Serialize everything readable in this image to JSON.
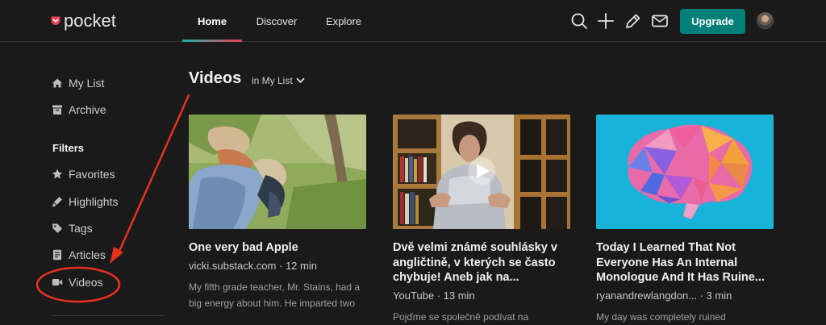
{
  "header": {
    "logo_text": "pocket",
    "nav": [
      {
        "label": "Home",
        "active": true
      },
      {
        "label": "Discover",
        "active": false
      },
      {
        "label": "Explore",
        "active": false
      }
    ],
    "icons": [
      "search-icon",
      "plus-icon",
      "pencil-icon",
      "mail-icon"
    ],
    "upgrade_label": "Upgrade",
    "accent_color": "#008078"
  },
  "sidebar": {
    "items": [
      {
        "label": "My List",
        "icon": "home-icon"
      },
      {
        "label": "Archive",
        "icon": "archive-icon"
      }
    ],
    "filters_heading": "Filters",
    "filters": [
      {
        "label": "Favorites",
        "icon": "star-icon"
      },
      {
        "label": "Highlights",
        "icon": "highlighter-icon"
      },
      {
        "label": "Tags",
        "icon": "tag-icon"
      },
      {
        "label": "Articles",
        "icon": "article-icon"
      },
      {
        "label": "Videos",
        "icon": "video-icon",
        "active": true
      }
    ]
  },
  "main": {
    "title": "Videos",
    "filter_label": "in My List",
    "cards": [
      {
        "title": "One very bad Apple",
        "source": "vicki.substack.com",
        "separator": " · ",
        "duration": "12 min",
        "excerpt": "My fifth grade teacher, Mr. Stains, had a big energy about him. He imparted two"
      },
      {
        "title": "Dvě velmi známé souhlásky v angličtině, v kterých se často chybuje! Aneb jak na...",
        "source": "YouTube",
        "separator": " · ",
        "duration": "13 min",
        "excerpt": "Pojďme se společně podívat na"
      },
      {
        "title": "Today I Learned That Not Everyone Has An Internal Monologue And It Has Ruine...",
        "source": "ryanandrewlangdon...",
        "separator": " · ",
        "duration": "3 min",
        "excerpt": "My day was completely ruined"
      }
    ]
  },
  "annotation": {
    "color": "#e8321e"
  }
}
